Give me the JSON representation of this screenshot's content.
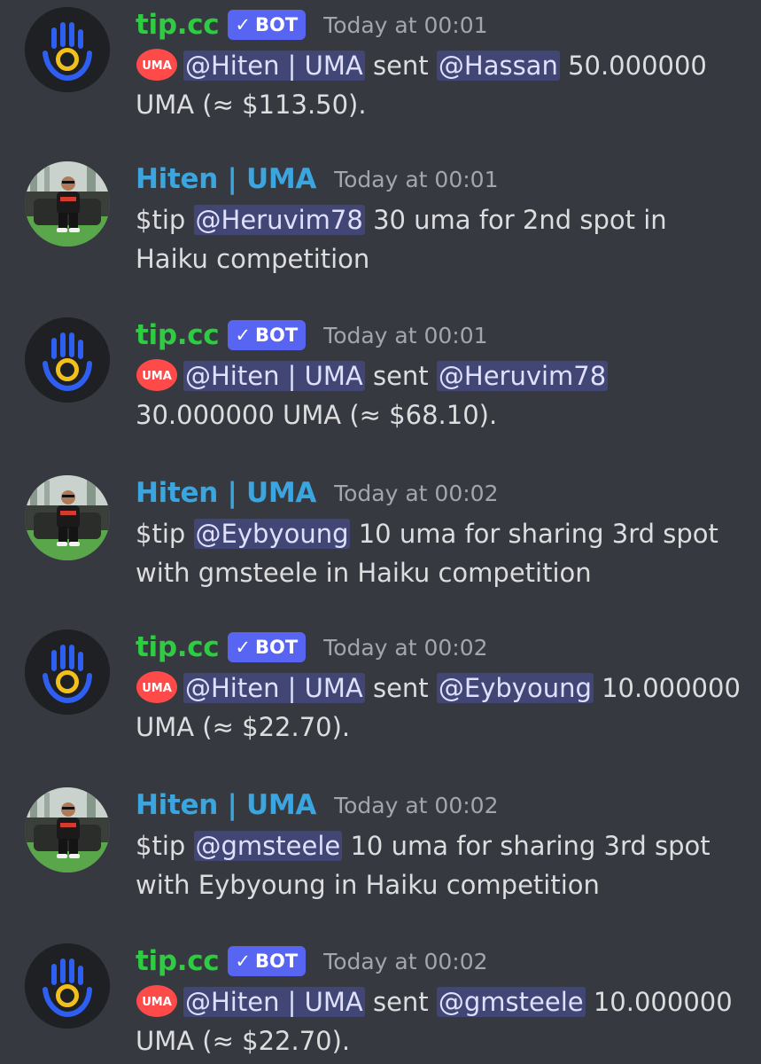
{
  "colors": {
    "background": "#36393f",
    "bot_name": "#2ecc40",
    "user_name": "#3ba5e0",
    "bot_tag": "#5865f2",
    "mention_bg": "#414675",
    "uma_red": "#ff4a4a"
  },
  "bot_tag_label": "BOT",
  "bot_tag_check": "✓",
  "icons": {
    "bot_avatar": "tipcc-hand-icon",
    "user_avatar": "user-photo",
    "uma": "uma-token-icon"
  },
  "messages": [
    {
      "author": "tip.cc",
      "timestamp": "Today at 00:01",
      "sender": "@Hiten | UMA",
      "verb": "sent",
      "recipient": "@Hassan",
      "amount": "50.000000",
      "amount_suffix": "UMA (≈ $113.50)."
    },
    {
      "author": "Hiten | UMA",
      "timestamp": "Today at 00:01",
      "command": "$tip",
      "mention": "@Heruvim78",
      "text": "30 uma for 2nd spot in Haiku competition"
    },
    {
      "author": "tip.cc",
      "timestamp": "Today at 00:01",
      "sender": "@Hiten | UMA",
      "verb": "sent",
      "recipient": "@Heruvim78",
      "amount": "30.000000",
      "amount_suffix": "UMA (≈ $68.10)."
    },
    {
      "author": "Hiten | UMA",
      "timestamp": "Today at 00:02",
      "command": "$tip",
      "mention": "@Eybyoung",
      "text": "10 uma for sharing 3rd spot with gmsteele in Haiku competition"
    },
    {
      "author": "tip.cc",
      "timestamp": "Today at 00:02",
      "sender": "@Hiten | UMA",
      "verb": "sent",
      "recipient": "@Eybyoung",
      "amount": "10.000000",
      "amount_suffix": "UMA (≈ $22.70)."
    },
    {
      "author": "Hiten | UMA",
      "timestamp": "Today at 00:02",
      "command": "$tip",
      "mention": "@gmsteele",
      "text": "10 uma for sharing 3rd spot with Eybyoung in Haiku competition"
    },
    {
      "author": "tip.cc",
      "timestamp": "Today at 00:02",
      "sender": "@Hiten | UMA",
      "verb": "sent",
      "recipient": "@gmsteele",
      "amount": "10.000000",
      "amount_suffix": "UMA (≈ $22.70)."
    }
  ]
}
